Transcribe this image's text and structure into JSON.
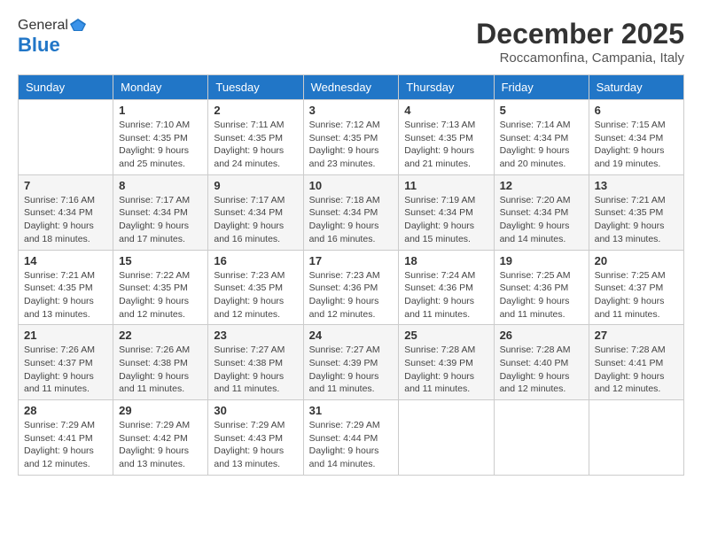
{
  "logo": {
    "general": "General",
    "blue": "Blue"
  },
  "title": "December 2025",
  "location": "Roccamonfina, Campania, Italy",
  "days_header": [
    "Sunday",
    "Monday",
    "Tuesday",
    "Wednesday",
    "Thursday",
    "Friday",
    "Saturday"
  ],
  "weeks": [
    [
      {
        "day": "",
        "info": ""
      },
      {
        "day": "1",
        "info": "Sunrise: 7:10 AM\nSunset: 4:35 PM\nDaylight: 9 hours\nand 25 minutes."
      },
      {
        "day": "2",
        "info": "Sunrise: 7:11 AM\nSunset: 4:35 PM\nDaylight: 9 hours\nand 24 minutes."
      },
      {
        "day": "3",
        "info": "Sunrise: 7:12 AM\nSunset: 4:35 PM\nDaylight: 9 hours\nand 23 minutes."
      },
      {
        "day": "4",
        "info": "Sunrise: 7:13 AM\nSunset: 4:35 PM\nDaylight: 9 hours\nand 21 minutes."
      },
      {
        "day": "5",
        "info": "Sunrise: 7:14 AM\nSunset: 4:34 PM\nDaylight: 9 hours\nand 20 minutes."
      },
      {
        "day": "6",
        "info": "Sunrise: 7:15 AM\nSunset: 4:34 PM\nDaylight: 9 hours\nand 19 minutes."
      }
    ],
    [
      {
        "day": "7",
        "info": "Sunrise: 7:16 AM\nSunset: 4:34 PM\nDaylight: 9 hours\nand 18 minutes."
      },
      {
        "day": "8",
        "info": "Sunrise: 7:17 AM\nSunset: 4:34 PM\nDaylight: 9 hours\nand 17 minutes."
      },
      {
        "day": "9",
        "info": "Sunrise: 7:17 AM\nSunset: 4:34 PM\nDaylight: 9 hours\nand 16 minutes."
      },
      {
        "day": "10",
        "info": "Sunrise: 7:18 AM\nSunset: 4:34 PM\nDaylight: 9 hours\nand 16 minutes."
      },
      {
        "day": "11",
        "info": "Sunrise: 7:19 AM\nSunset: 4:34 PM\nDaylight: 9 hours\nand 15 minutes."
      },
      {
        "day": "12",
        "info": "Sunrise: 7:20 AM\nSunset: 4:34 PM\nDaylight: 9 hours\nand 14 minutes."
      },
      {
        "day": "13",
        "info": "Sunrise: 7:21 AM\nSunset: 4:35 PM\nDaylight: 9 hours\nand 13 minutes."
      }
    ],
    [
      {
        "day": "14",
        "info": "Sunrise: 7:21 AM\nSunset: 4:35 PM\nDaylight: 9 hours\nand 13 minutes."
      },
      {
        "day": "15",
        "info": "Sunrise: 7:22 AM\nSunset: 4:35 PM\nDaylight: 9 hours\nand 12 minutes."
      },
      {
        "day": "16",
        "info": "Sunrise: 7:23 AM\nSunset: 4:35 PM\nDaylight: 9 hours\nand 12 minutes."
      },
      {
        "day": "17",
        "info": "Sunrise: 7:23 AM\nSunset: 4:36 PM\nDaylight: 9 hours\nand 12 minutes."
      },
      {
        "day": "18",
        "info": "Sunrise: 7:24 AM\nSunset: 4:36 PM\nDaylight: 9 hours\nand 11 minutes."
      },
      {
        "day": "19",
        "info": "Sunrise: 7:25 AM\nSunset: 4:36 PM\nDaylight: 9 hours\nand 11 minutes."
      },
      {
        "day": "20",
        "info": "Sunrise: 7:25 AM\nSunset: 4:37 PM\nDaylight: 9 hours\nand 11 minutes."
      }
    ],
    [
      {
        "day": "21",
        "info": "Sunrise: 7:26 AM\nSunset: 4:37 PM\nDaylight: 9 hours\nand 11 minutes."
      },
      {
        "day": "22",
        "info": "Sunrise: 7:26 AM\nSunset: 4:38 PM\nDaylight: 9 hours\nand 11 minutes."
      },
      {
        "day": "23",
        "info": "Sunrise: 7:27 AM\nSunset: 4:38 PM\nDaylight: 9 hours\nand 11 minutes."
      },
      {
        "day": "24",
        "info": "Sunrise: 7:27 AM\nSunset: 4:39 PM\nDaylight: 9 hours\nand 11 minutes."
      },
      {
        "day": "25",
        "info": "Sunrise: 7:28 AM\nSunset: 4:39 PM\nDaylight: 9 hours\nand 11 minutes."
      },
      {
        "day": "26",
        "info": "Sunrise: 7:28 AM\nSunset: 4:40 PM\nDaylight: 9 hours\nand 12 minutes."
      },
      {
        "day": "27",
        "info": "Sunrise: 7:28 AM\nSunset: 4:41 PM\nDaylight: 9 hours\nand 12 minutes."
      }
    ],
    [
      {
        "day": "28",
        "info": "Sunrise: 7:29 AM\nSunset: 4:41 PM\nDaylight: 9 hours\nand 12 minutes."
      },
      {
        "day": "29",
        "info": "Sunrise: 7:29 AM\nSunset: 4:42 PM\nDaylight: 9 hours\nand 13 minutes."
      },
      {
        "day": "30",
        "info": "Sunrise: 7:29 AM\nSunset: 4:43 PM\nDaylight: 9 hours\nand 13 minutes."
      },
      {
        "day": "31",
        "info": "Sunrise: 7:29 AM\nSunset: 4:44 PM\nDaylight: 9 hours\nand 14 minutes."
      },
      {
        "day": "",
        "info": ""
      },
      {
        "day": "",
        "info": ""
      },
      {
        "day": "",
        "info": ""
      }
    ]
  ]
}
